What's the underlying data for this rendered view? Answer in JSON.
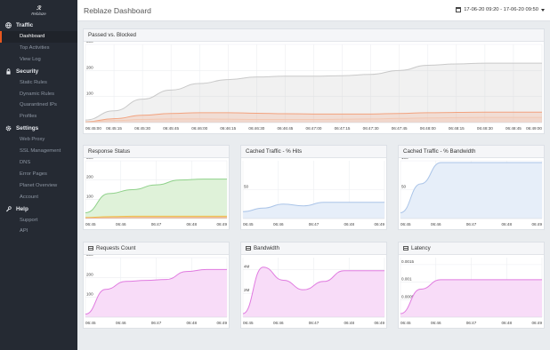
{
  "app": {
    "logo_text": "Reblaze",
    "title": "Reblaze Dashboard",
    "date_range": "17-06-20 09:20 - 17-06-20 09:50"
  },
  "sidebar": {
    "sections": [
      {
        "label": "Traffic",
        "icon": "globe-icon",
        "items": [
          "Dashboard",
          "Top Activities",
          "View Log"
        ]
      },
      {
        "label": "Security",
        "icon": "lock-icon",
        "items": [
          "Static Rules",
          "Dynamic Rules",
          "Quarantined IPs",
          "Profiles"
        ]
      },
      {
        "label": "Settings",
        "icon": "gear-icon",
        "items": [
          "Web Proxy",
          "SSL Management",
          "DNS",
          "Error Pages",
          "Planet Overview",
          "Account"
        ]
      },
      {
        "label": "Help",
        "icon": "wrench-icon",
        "items": [
          "Support",
          "API"
        ]
      }
    ],
    "active_item": "Dashboard",
    "accent": "#e8571e"
  },
  "panels": {
    "passed_blocked": {
      "title": "Passed vs. Blocked"
    },
    "response_status": {
      "title": "Response Status"
    },
    "cached_hits": {
      "title": "Cached Traffic - % Hits"
    },
    "cached_bandwidth": {
      "title": "Cached Traffic - % Bandwidth"
    },
    "requests_count": {
      "title": "Requests Count"
    },
    "bandwidth": {
      "title": "Bandwidth"
    },
    "latency": {
      "title": "Latency"
    }
  },
  "chart_data": [
    {
      "id": "passed_blocked",
      "type": "area",
      "title": "Passed vs. Blocked",
      "x": [
        "06:45:00",
        "06:45:15",
        "06:45:30",
        "06:45:45",
        "06:46:00",
        "06:46:15",
        "06:46:30",
        "06:46:45",
        "06:47:00",
        "06:47:15",
        "06:47:30",
        "06:47:45",
        "06:48:00",
        "06:48:15",
        "06:48:30",
        "06:48:45",
        "06:49:00"
      ],
      "x_tick_labels": [
        "06:45:00",
        "06:45:15",
        "06:45:30",
        "06:45:45",
        "06:46:00",
        "06:46:15",
        "06:46:30",
        "06:46:45",
        "06:47:00",
        "06:47:15",
        "06:47:30",
        "06:47:45",
        "06:48:00",
        "06:48:15",
        "06:48:30",
        "06:48:45",
        "06:49:00"
      ],
      "yticks": [
        100,
        200,
        300
      ],
      "ylim": [
        0,
        300
      ],
      "series": [
        {
          "color": "#c9c9c9",
          "values": [
            10,
            45,
            90,
            125,
            150,
            165,
            175,
            178,
            178,
            180,
            185,
            200,
            220,
            225,
            228,
            228,
            228
          ]
        },
        {
          "color": "#f2a27e",
          "values": [
            3,
            15,
            28,
            35,
            38,
            38,
            36,
            34,
            33,
            33,
            33,
            35,
            38,
            39,
            40,
            40,
            40
          ]
        },
        {
          "color": "#f3c9b4",
          "values": [
            2,
            8,
            12,
            14,
            14,
            13,
            12,
            12,
            12,
            13,
            14,
            16,
            18,
            19,
            20,
            20,
            20
          ]
        }
      ]
    },
    {
      "id": "response_status",
      "type": "area",
      "title": "Response Status",
      "x": [
        "06:45",
        "06:46",
        "06:47",
        "06:48",
        "06:49"
      ],
      "yticks": [
        100,
        200,
        300
      ],
      "ylim": [
        0,
        300
      ],
      "series": [
        {
          "color": "#8fd18a",
          "fill": "#dff2d9",
          "values": [
            30,
            130,
            150,
            175,
            200,
            205,
            205
          ]
        },
        {
          "color": "#f0c04a",
          "values": [
            5,
            10,
            12,
            12,
            12,
            12,
            12
          ]
        },
        {
          "color": "#f4a582",
          "values": [
            2,
            4,
            5,
            5,
            5,
            5,
            5
          ]
        }
      ]
    },
    {
      "id": "cached_hits",
      "type": "area",
      "title": "Cached Traffic - % Hits",
      "x": [
        "06:45",
        "06:46",
        "06:47",
        "06:48",
        "06:49"
      ],
      "yticks": [
        50
      ],
      "ylim": [
        0,
        100
      ],
      "series": [
        {
          "color": "#aac4e8",
          "fill": "#e6eef9",
          "values": [
            12,
            18,
            25,
            22,
            28,
            28,
            28,
            28
          ]
        }
      ]
    },
    {
      "id": "cached_bandwidth",
      "type": "area",
      "title": "Cached Traffic - % Bandwidth",
      "x": [
        "06:45",
        "06:46",
        "06:47",
        "06:48",
        "06:49"
      ],
      "yticks": [
        50,
        100
      ],
      "ylim": [
        0,
        100
      ],
      "series": [
        {
          "color": "#aac4e8",
          "fill": "#e6eef9",
          "values": [
            10,
            60,
            97,
            97,
            97,
            97,
            97,
            97
          ]
        }
      ]
    },
    {
      "id": "requests_count",
      "type": "area",
      "title": "Requests Count",
      "x": [
        "06:45",
        "06:46",
        "06:47",
        "06:48",
        "06:49"
      ],
      "yticks": [
        100,
        200,
        300
      ],
      "ylim": [
        0,
        300
      ],
      "series": [
        {
          "color": "#e07be0",
          "fill": "#f8dcf8",
          "values": [
            15,
            140,
            180,
            185,
            190,
            230,
            240,
            240
          ]
        }
      ]
    },
    {
      "id": "bandwidth",
      "type": "area",
      "title": "Bandwidth",
      "x": [
        "06:45",
        "06:46",
        "06:47",
        "06:48",
        "06:49"
      ],
      "ytick_labels": [
        "2M",
        "4M"
      ],
      "yticks": [
        2,
        4
      ],
      "ylim": [
        0,
        5
      ],
      "series": [
        {
          "color": "#e07be0",
          "fill": "#f8dcf8",
          "values": [
            0.3,
            4.2,
            3.1,
            2.3,
            3.0,
            3.9,
            3.9,
            3.9
          ]
        }
      ]
    },
    {
      "id": "latency",
      "type": "area",
      "title": "Latency",
      "x": [
        "06:45",
        "06:46",
        "06:47",
        "06:48",
        "06:49"
      ],
      "yticks": [
        0.0005,
        0.001,
        0.0015
      ],
      "ylim": [
        0,
        0.0017
      ],
      "series": [
        {
          "color": "#e07be0",
          "fill": "#f8dcf8",
          "values": [
            0.0001,
            0.0008,
            0.00107,
            0.00107,
            0.00107,
            0.00107,
            0.00107,
            0.00107
          ]
        }
      ]
    }
  ]
}
